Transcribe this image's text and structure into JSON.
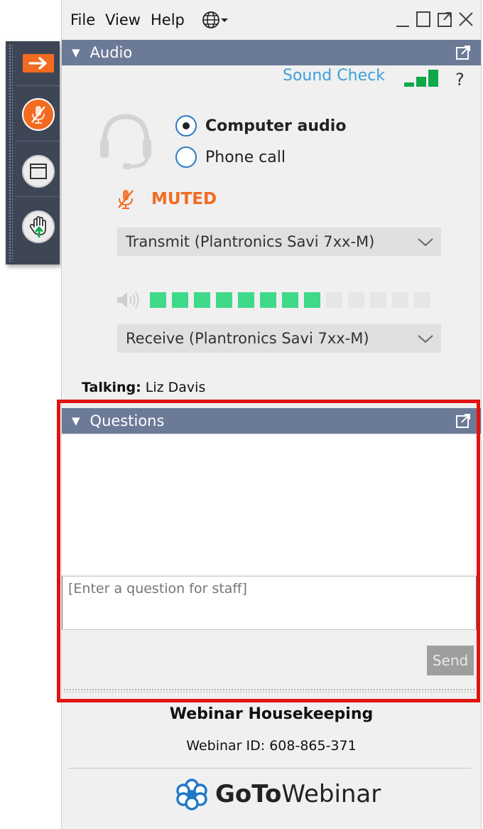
{
  "menubar": {
    "file": "File",
    "view": "View",
    "help": "Help"
  },
  "audio": {
    "header": "Audio",
    "sound_check": "Sound Check",
    "help_mark": "?",
    "options": [
      {
        "label": "Computer audio",
        "selected": true
      },
      {
        "label": "Phone call",
        "selected": false
      }
    ],
    "muted_label": "MUTED",
    "transmit_device": "Transmit (Plantronics Savi 7xx-M)",
    "receive_device": "Receive (Plantronics Savi 7xx-M)",
    "level": {
      "active_segments": 8,
      "total_segments": 13
    },
    "signal_bars": 3
  },
  "talking": {
    "label": "Talking:",
    "name": "Liz Davis"
  },
  "questions": {
    "header": "Questions",
    "input_placeholder": "[Enter a question for staff]",
    "send_label": "Send"
  },
  "webinar": {
    "title": "Webinar Housekeeping",
    "id_text": "Webinar ID: 608-865-371",
    "brand_go": "GoTo",
    "brand_rest": "Webinar"
  },
  "colors": {
    "accent_orange": "#f26b21",
    "header_blue": "#6b7a96",
    "level_green": "#3fd98a",
    "level_off": "#e6e6e6",
    "link_blue": "#3aa0d8",
    "highlight_red": "#e11212"
  }
}
